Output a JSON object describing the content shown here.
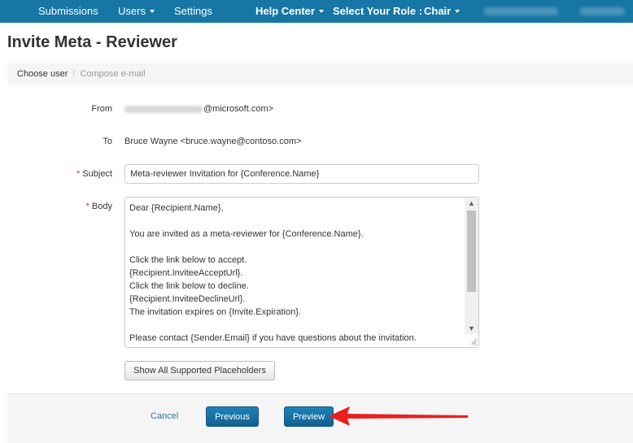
{
  "nav": {
    "submissions": "Submissions",
    "users": "Users",
    "settings": "Settings",
    "help_center": "Help Center",
    "select_role_label": "Select Your Role :",
    "role_value": "Chair"
  },
  "page": {
    "title": "Invite Meta - Reviewer"
  },
  "breadcrumb": {
    "step1": "Choose user",
    "separator": "/",
    "step2": "Compose e-mail"
  },
  "form": {
    "from_label": "From",
    "from_value_suffix": "@microsoft.com>",
    "to_label": "To",
    "to_value": "Bruce Wayne <bruce.wayne@contoso.com>",
    "required_marker": "*",
    "subject_label": "Subject",
    "subject_value": "Meta-reviewer Invitation for {Conference.Name}",
    "body_label": "Body",
    "body_lines": [
      "Dear {Recipient.Name},",
      "",
      "You are invited as a meta-reviewer for {Conference.Name}.",
      "",
      "Click the link below to accept.",
      "{Recipient.InviteeAcceptUrl}.",
      "Click the link below to decline.",
      "{Recipient.InviteeDeclineUrl}.",
      "The invitation expires on {Invite.Expiration}.",
      "",
      "Please contact {Sender.Email} if you have questions about the invitation."
    ],
    "placeholders_button": "Show All Supported Placeholders"
  },
  "footer": {
    "cancel": "Cancel",
    "previous": "Previous",
    "preview": "Preview"
  },
  "icons": {
    "scroll_up": "▲",
    "scroll_down": "▼"
  },
  "colors": {
    "nav_background": "#1676a5",
    "primary_button": "#1f82b8",
    "required": "#c9302c",
    "annotation_arrow": "#e8201e"
  }
}
